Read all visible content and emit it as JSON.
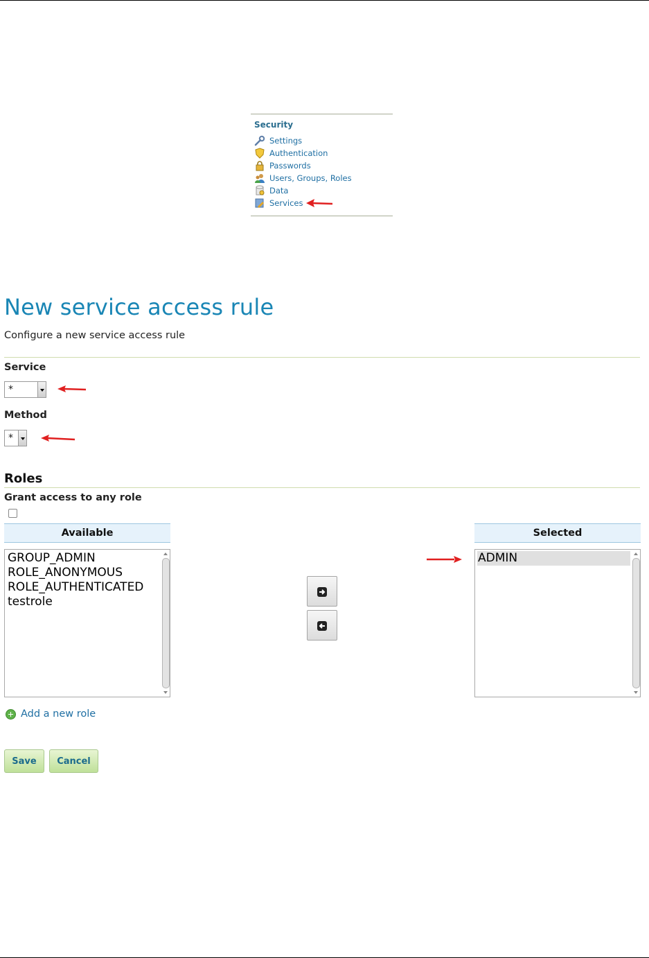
{
  "security_menu": {
    "title": "Security",
    "items": [
      {
        "label": "Settings",
        "icon": "wrench-icon"
      },
      {
        "label": "Authentication",
        "icon": "shield-icon"
      },
      {
        "label": "Passwords",
        "icon": "lock-icon"
      },
      {
        "label": "Users, Groups, Roles",
        "icon": "users-icon"
      },
      {
        "label": "Data",
        "icon": "database-icon"
      },
      {
        "label": "Services",
        "icon": "services-icon"
      }
    ]
  },
  "form": {
    "title": "New service access rule",
    "description": "Configure a new service access rule",
    "service": {
      "label": "Service",
      "value": "*"
    },
    "method": {
      "label": "Method",
      "value": "*"
    }
  },
  "roles": {
    "heading": "Roles",
    "grant_any_label": "Grant access to any role",
    "grant_any_checked": false,
    "available_header": "Available",
    "available_items": [
      "GROUP_ADMIN",
      "ROLE_ANONYMOUS",
      "ROLE_AUTHENTICATED",
      "testrole"
    ],
    "selected_header": "Selected",
    "selected_items": [
      "ADMIN"
    ],
    "add_role_label": "Add a new role"
  },
  "buttons": {
    "save": "Save",
    "cancel": "Cancel"
  },
  "colors": {
    "title": "#1a86b5",
    "link": "#1f6fa3",
    "annotation_arrow": "#e02020",
    "button_green": "#bfe099"
  }
}
